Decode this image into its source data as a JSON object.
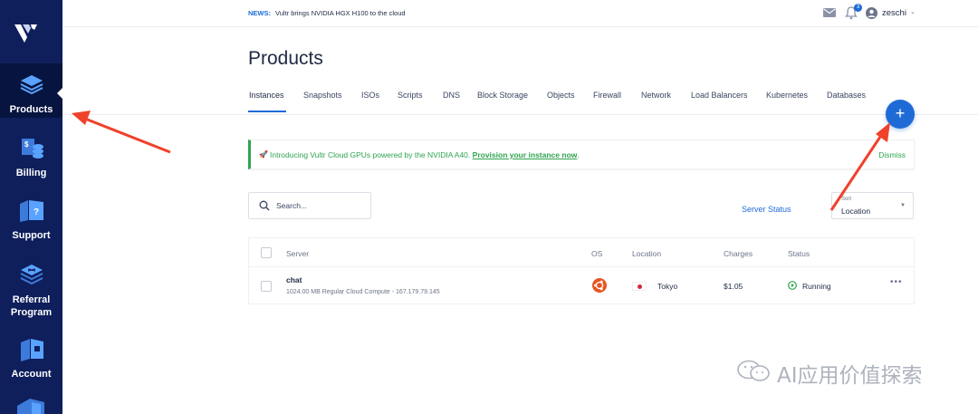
{
  "sidebar": {
    "items": [
      {
        "label": "Products",
        "icon": "layers-icon",
        "active": true
      },
      {
        "label": "Billing",
        "icon": "billing-icon",
        "active": false
      },
      {
        "label": "Support",
        "icon": "support-icon",
        "active": false
      },
      {
        "label": "Referral\nProgram",
        "label_line1": "Referral",
        "label_line2": "Program",
        "icon": "referral-icon",
        "active": false
      },
      {
        "label": "Account",
        "icon": "account-icon",
        "active": false
      }
    ]
  },
  "news": {
    "tag": "NEWS:",
    "text": "Vultr brings NVIDIA HGX H100 to the cloud"
  },
  "header": {
    "notification_count": "3",
    "username": "zeschi"
  },
  "page": {
    "title": "Products"
  },
  "tabs": [
    {
      "label": "Instances",
      "active": true
    },
    {
      "label": "Snapshots"
    },
    {
      "label": "ISOs"
    },
    {
      "label": "Scripts"
    },
    {
      "label": "DNS"
    },
    {
      "label": "Block Storage"
    },
    {
      "label": "Objects"
    },
    {
      "label": "Firewall"
    },
    {
      "label": "Network"
    },
    {
      "label": "Load Balancers"
    },
    {
      "label": "Kubernetes"
    },
    {
      "label": "Databases"
    }
  ],
  "fab": {
    "label": "+"
  },
  "banner": {
    "text": "Introducing Vultr Cloud GPUs powered by the NVIDIA A40.",
    "link": "Provision your instance now",
    "suffix": ".",
    "dismiss": "Dismiss"
  },
  "search": {
    "placeholder": "Search..."
  },
  "server_status": "Server Status",
  "sort": {
    "label": "Sort",
    "value": "Location"
  },
  "table": {
    "columns": [
      "Server",
      "OS",
      "Location",
      "Charges",
      "Status"
    ],
    "rows": [
      {
        "name": "chat",
        "meta": "1024.00 MB Regular Cloud Compute - 167.179.79.145",
        "os": "ubuntu-icon",
        "location": "Tokyo",
        "charges": "$1.05",
        "status": "Running"
      }
    ]
  },
  "watermark": {
    "text": "AI应用价值探索"
  },
  "colors": {
    "sidebar": "#0e1f5b",
    "accent": "#1e6bd6",
    "success": "#2ea44f",
    "annotation": "#f0412b"
  }
}
